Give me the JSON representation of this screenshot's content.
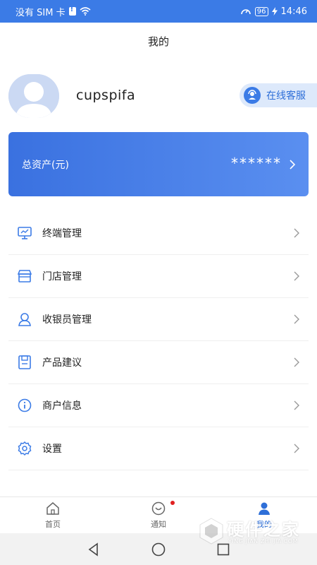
{
  "statusbar": {
    "carrier": "没有 SIM 卡",
    "battery": "96",
    "time": "14:46"
  },
  "header": {
    "title": "我的"
  },
  "profile": {
    "username": "cupspifa",
    "service_label": "在线客服"
  },
  "asset": {
    "label": "总资产(元)",
    "value": "******"
  },
  "menu": {
    "items": [
      {
        "label": "终端管理",
        "icon": "monitor-icon"
      },
      {
        "label": "门店管理",
        "icon": "store-icon"
      },
      {
        "label": "收银员管理",
        "icon": "cashier-icon"
      },
      {
        "label": "产品建议",
        "icon": "suggestion-icon"
      },
      {
        "label": "商户信息",
        "icon": "info-icon"
      },
      {
        "label": "设置",
        "icon": "gear-icon"
      }
    ]
  },
  "tabbar": {
    "tabs": [
      {
        "label": "首页",
        "icon": "home-icon"
      },
      {
        "label": "通知",
        "icon": "notification-icon"
      },
      {
        "label": "我的",
        "icon": "profile-icon"
      }
    ]
  },
  "watermark": {
    "main": "硬件之家",
    "sub": "YING JIAN ZHI JIA.COM"
  },
  "colors": {
    "primary": "#3b7be6",
    "card_start": "#3a71e0",
    "card_end": "#5a8ff0",
    "service_bg": "#dde9fb",
    "badge": "#e02020"
  }
}
